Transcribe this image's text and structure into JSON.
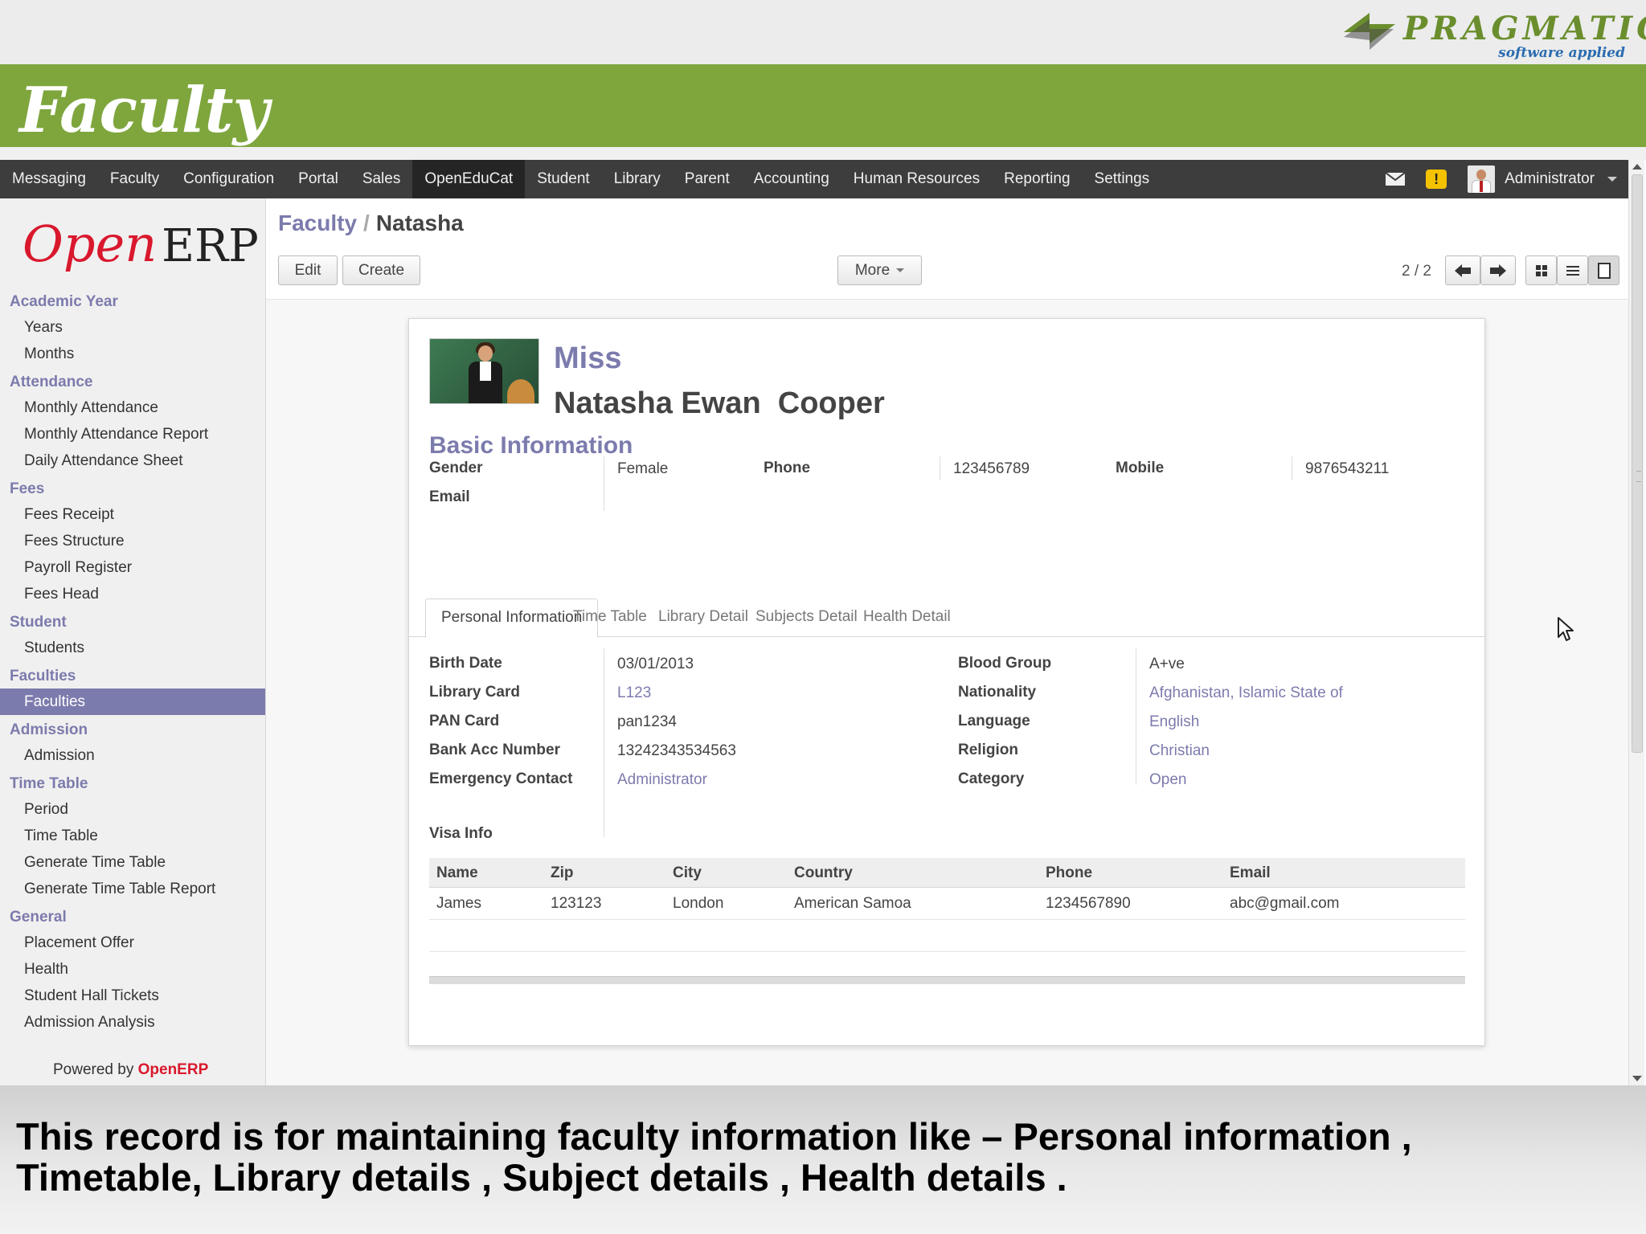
{
  "slide": {
    "title": "Faculty",
    "brand_word": "PRAGMATIC",
    "brand_tagline": "software applied",
    "caption": "This record is for maintaining faculty information like – Personal information , Timetable, Library details , Subject details , Health details ."
  },
  "topnav": {
    "items": [
      "Messaging",
      "Faculty",
      "Configuration",
      "Portal",
      "Sales",
      "OpenEduCat",
      "Student",
      "Library",
      "Parent",
      "Accounting",
      "Human Resources",
      "Reporting",
      "Settings"
    ],
    "active": "OpenEduCat",
    "user": "Administrator",
    "icons": [
      "mail-icon",
      "warning-icon"
    ]
  },
  "sidebar": {
    "logo_open": "Open",
    "logo_erp": "ERP",
    "sections": [
      {
        "title": "Academic Year",
        "items": [
          "Years",
          "Months"
        ]
      },
      {
        "title": "Attendance",
        "items": [
          "Monthly Attendance",
          "Monthly Attendance Report",
          "Daily Attendance Sheet"
        ]
      },
      {
        "title": "Fees",
        "items": [
          "Fees Receipt",
          "Fees Structure",
          "Payroll Register",
          "Fees Head"
        ]
      },
      {
        "title": "Student",
        "items": [
          "Students"
        ]
      },
      {
        "title": "Faculties",
        "items": [
          "Faculties"
        ]
      },
      {
        "title": "Admission",
        "items": [
          "Admission"
        ]
      },
      {
        "title": "Time Table",
        "items": [
          "Period",
          "Time Table",
          "Generate Time Table",
          "Generate Time Table Report"
        ]
      },
      {
        "title": "General",
        "items": [
          "Placement Offer",
          "Health",
          "Student Hall Tickets",
          "Admission Analysis"
        ]
      }
    ],
    "active_item": "Faculties",
    "powered_prefix": "Powered by",
    "powered_brand": "OpenERP"
  },
  "control_panel": {
    "breadcrumb_parent": "Faculty",
    "breadcrumb_sep": "/",
    "breadcrumb_current": "Natasha",
    "edit_label": "Edit",
    "create_label": "Create",
    "more_label": "More",
    "pager": "2 / 2"
  },
  "record": {
    "title": "Miss",
    "full_name": "Natasha Ewan  Cooper",
    "section_title": "Basic Information",
    "gender_label": "Gender",
    "gender": "Female",
    "phone_label": "Phone",
    "phone": "123456789",
    "mobile_label": "Mobile",
    "mobile": "9876543211",
    "email_label": "Email"
  },
  "tabs": [
    "Personal Information",
    "Time Table",
    "Library Detail",
    "Subjects Detail",
    "Health Detail"
  ],
  "active_tab": "Personal Information",
  "personal": {
    "left": [
      {
        "label": "Birth Date",
        "value": "03/01/2013",
        "link": false
      },
      {
        "label": "Library Card",
        "value": "L123",
        "link": true
      },
      {
        "label": "PAN Card",
        "value": "pan1234",
        "link": false
      },
      {
        "label": "Bank Acc Number",
        "value": "13242343534563",
        "link": false
      },
      {
        "label": "Emergency Contact",
        "value": "Administrator",
        "link": true
      }
    ],
    "right": [
      {
        "label": "Blood Group",
        "value": "A+ve",
        "link": false
      },
      {
        "label": "Nationality",
        "value": "Afghanistan, Islamic State of",
        "link": true
      },
      {
        "label": "Language",
        "value": "English",
        "link": true
      },
      {
        "label": "Religion",
        "value": "Christian",
        "link": true
      },
      {
        "label": "Category",
        "value": "Open",
        "link": true
      }
    ],
    "visa_label": "Visa Info"
  },
  "visa_table": {
    "headers": [
      "Name",
      "Zip",
      "City",
      "Country",
      "Phone",
      "Email"
    ],
    "rows": [
      [
        "James",
        "123123",
        "London",
        "American Samoa",
        "1234567890",
        "abc@gmail.com"
      ]
    ]
  },
  "colors": {
    "green_bar": "#7ea63d",
    "accent": "#7c7bad",
    "nav_bg": "#3d3d3d",
    "openerp_red": "#d9182d"
  }
}
